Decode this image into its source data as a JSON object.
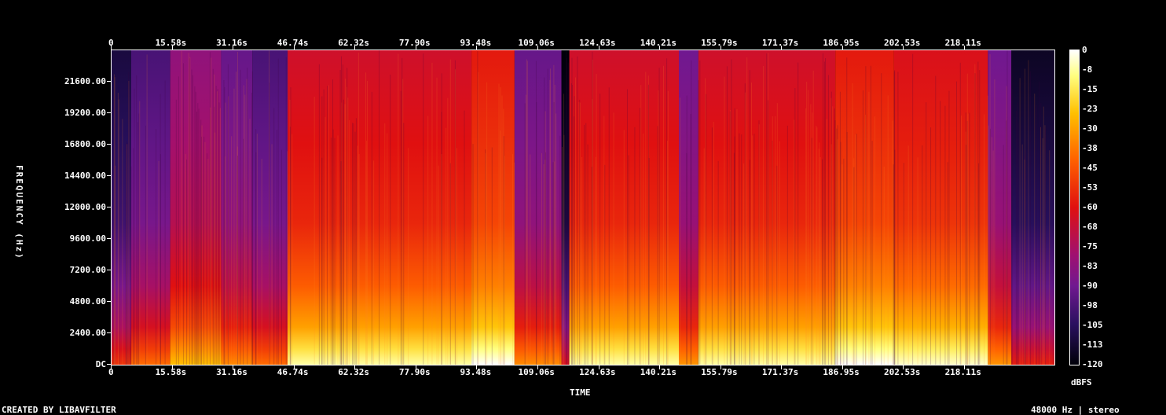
{
  "chart_data": {
    "type": "heatmap",
    "title": "",
    "xlabel": "TIME",
    "ylabel": "FREQUENCY (Hz)",
    "x_ticks": [
      "0",
      "15.58s",
      "31.16s",
      "46.74s",
      "62.32s",
      "77.90s",
      "93.48s",
      "109.06s",
      "124.63s",
      "140.21s",
      "155.79s",
      "171.37s",
      "186.95s",
      "202.53s",
      "218.11s"
    ],
    "y_ticks": [
      "DC",
      "2400.00",
      "4800.00",
      "7200.00",
      "9600.00",
      "12000.00",
      "14400.00",
      "16800.00",
      "19200.00",
      "21600.00"
    ],
    "xlim": [
      0,
      241
    ],
    "ylim": [
      0,
      24000
    ],
    "colorbar": {
      "label": "dBFS",
      "ticks": [
        "0",
        "-8",
        "-15",
        "-23",
        "-30",
        "-38",
        "-45",
        "-53",
        "-60",
        "-68",
        "-75",
        "-83",
        "-90",
        "-98",
        "-105",
        "-113",
        "-120"
      ],
      "range": [
        -120,
        0
      ]
    },
    "segments": [
      {
        "t0": 0,
        "t1": 5,
        "level": -100
      },
      {
        "t0": 5,
        "t1": 15,
        "level": -88
      },
      {
        "t0": 15,
        "t1": 28,
        "level": -72
      },
      {
        "t0": 28,
        "t1": 36,
        "level": -82
      },
      {
        "t0": 36,
        "t1": 45,
        "level": -88
      },
      {
        "t0": 45,
        "t1": 92,
        "level": -55
      },
      {
        "t0": 92,
        "t1": 103,
        "level": -48
      },
      {
        "t0": 103,
        "t1": 115,
        "level": -82
      },
      {
        "t0": 115,
        "t1": 117,
        "level": -110
      },
      {
        "t0": 117,
        "t1": 145,
        "level": -55
      },
      {
        "t0": 145,
        "t1": 150,
        "level": -80
      },
      {
        "t0": 150,
        "t1": 185,
        "level": -55
      },
      {
        "t0": 185,
        "t1": 200,
        "level": -48
      },
      {
        "t0": 200,
        "t1": 224,
        "level": -52
      },
      {
        "t0": 224,
        "t1": 230,
        "level": -80
      },
      {
        "t0": 230,
        "t1": 241,
        "level": -105
      }
    ]
  },
  "footer": {
    "left": "CREATED BY LIBAVFILTER",
    "right": "48000 Hz | stereo"
  }
}
